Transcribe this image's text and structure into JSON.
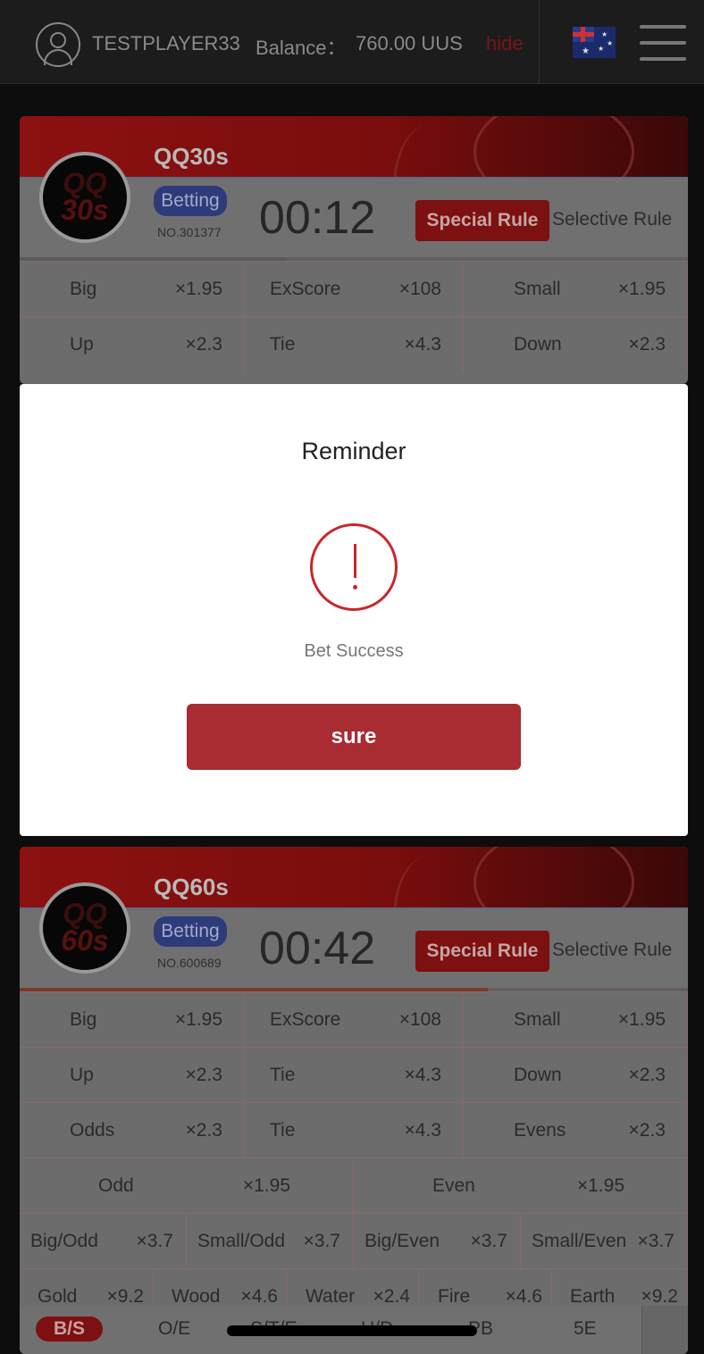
{
  "header": {
    "player": "TESTPLAYER33",
    "balance_label": "Balance：",
    "balance_value": "760.00 UUS",
    "hide_label": "hide",
    "flag_icon": "australia-flag-icon",
    "menu_icon": "hamburger-menu-icon"
  },
  "games": [
    {
      "title": "QQ30s",
      "logo_top": "QQ",
      "logo_bottom": "30s",
      "status": "Betting",
      "round_no": "NO.301377",
      "timer": "00:12",
      "special_rule": "Special Rule",
      "selective_rule": "Selective Rule",
      "progress": 0.4,
      "rows": [
        [
          [
            "Big",
            "×1.95"
          ],
          [
            "ExScore",
            "×108"
          ],
          [
            "Small",
            "×1.95"
          ]
        ],
        [
          [
            "Up",
            "×2.3"
          ],
          [
            "Tie",
            "×4.3"
          ],
          [
            "Down",
            "×2.3"
          ]
        ]
      ]
    },
    {
      "title": "QQ60s",
      "logo_top": "QQ",
      "logo_bottom": "60s",
      "status": "Betting",
      "round_no": "NO.600689",
      "timer": "00:42",
      "special_rule": "Special Rule",
      "selective_rule": "Selective Rule",
      "progress": 0.7,
      "rows3": [
        [
          [
            "Big",
            "×1.95"
          ],
          [
            "ExScore",
            "×108"
          ],
          [
            "Small",
            "×1.95"
          ]
        ],
        [
          [
            "Up",
            "×2.3"
          ],
          [
            "Tie",
            "×4.3"
          ],
          [
            "Down",
            "×2.3"
          ]
        ],
        [
          [
            "Odds",
            "×2.3"
          ],
          [
            "Tie",
            "×4.3"
          ],
          [
            "Evens",
            "×2.3"
          ]
        ]
      ],
      "row2": [
        [
          "Odd",
          "×1.95"
        ],
        [
          "Even",
          "×1.95"
        ]
      ],
      "row4": [
        [
          "Big/Odd",
          "×3.7"
        ],
        [
          "Small/Odd",
          "×3.7"
        ],
        [
          "Big/Even",
          "×3.7"
        ],
        [
          "Small/Even",
          "×3.7"
        ]
      ],
      "row5": [
        [
          "Gold",
          "×9.2"
        ],
        [
          "Wood",
          "×4.6"
        ],
        [
          "Water",
          "×2.4"
        ],
        [
          "Fire",
          "×4.6"
        ],
        [
          "Earth",
          "×9.2"
        ]
      ],
      "tabs": [
        "B/S",
        "O/E",
        "S/T/E",
        "U/D",
        "PB",
        "5E"
      ]
    }
  ],
  "modal": {
    "title": "Reminder",
    "icon": "warning-circle-icon",
    "message": "Bet Success",
    "button": "sure"
  },
  "colors": {
    "accent": "#a82c32",
    "warning": "#c9262b",
    "progress_fill_1": "#5a5a5a",
    "progress_fill_2": "#7a3a2a"
  }
}
